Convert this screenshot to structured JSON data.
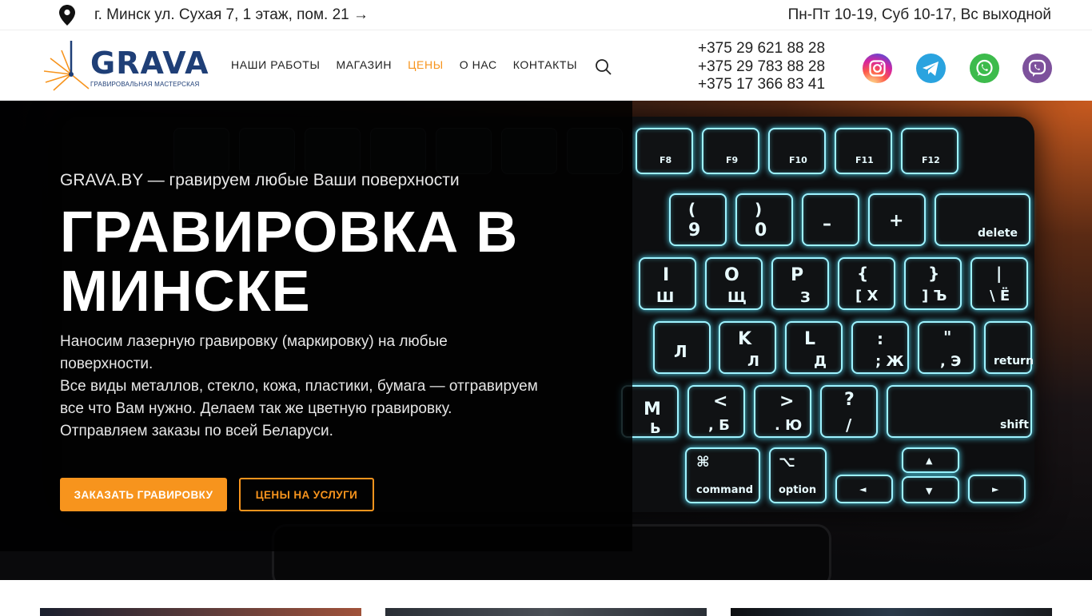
{
  "topbar": {
    "address": "г. Минск ул. Сухая 7, 1 этаж, пом. 21 →",
    "hours": "Пн-Пт 10-19, Суб 10-17, Вс выходной"
  },
  "header": {
    "logo_text": "GRAVA",
    "logo_sub": "ГРАВИРОВАЛЬНАЯ МАСТЕРСКАЯ",
    "nav": [
      {
        "label": "НАШИ РАБОТЫ",
        "active": false
      },
      {
        "label": "МАГАЗИН",
        "active": false
      },
      {
        "label": "ЦЕНЫ",
        "active": true
      },
      {
        "label": "О НАС",
        "active": false
      },
      {
        "label": "КОНТАКТЫ",
        "active": false
      }
    ],
    "phones": [
      "+375 29 621 88 28",
      "+375 29 783 88 28",
      "+375 17 366 83 41"
    ],
    "social": [
      "instagram-icon",
      "telegram-icon",
      "whatsapp-icon",
      "viber-icon"
    ],
    "accent_color": "#f7941d"
  },
  "hero": {
    "subtitle": "GRAVA.BY — гравируем любые Ваши поверхности",
    "title_line1": "ГРАВИРОВКА В",
    "title_line2": "МИНСКЕ",
    "desc_line1": "Наносим лазерную гравировку (маркировку) на любые поверхности.",
    "desc_line2": "Все виды металлов, стекло, кожа, пластики, бумага — отгравируем все что Вам нужно. Делаем так же цветную гравировку.",
    "desc_line3": "Отправляем заказы по всей Беларуси.",
    "btn_primary": "ЗАКАЗАТЬ ГРАВИРОВКУ",
    "btn_secondary": "ЦЕНЫ НА УСЛУГИ",
    "keys": {
      "f8": "F8",
      "f9": "F9",
      "f10": "F10",
      "f11": "F11",
      "f12": "F12",
      "n9": "9",
      "n9s": "(",
      "n0": "0",
      "n0s": ")",
      "minus": "–",
      "plus": "+",
      "del": "delete",
      "o": "O",
      "o_ru": "Щ",
      "p": "P",
      "p_ru": "З",
      "br1": "{",
      "br1_ru": "[ Х",
      "br2": "}",
      "br2_ru": "] Ъ",
      "bs": "|",
      "bs_ru": "\\ Ё",
      "i": "I",
      "i_ru": "Ш",
      "k": "K",
      "k_ru": "Л",
      "l": "L",
      "l_ru": "Д",
      "semi": ":",
      "semi_ru": "; Ж",
      "quote": "\"",
      "quote_ru": ", Э",
      "ret": "return",
      "m": "M",
      "m_ru": "Ь",
      "lt": "<",
      "lt_ru": ", Б",
      "gt": ">",
      "gt_ru": ". Ю",
      "q": "?",
      "q_ru": "/",
      "shift": "shift",
      "cmd_sym": "⌘",
      "cmd": "command",
      "opt_sym": "⌥",
      "opt": "option",
      "left": "◄",
      "up": "▲",
      "down": "▼",
      "right": "►"
    }
  }
}
